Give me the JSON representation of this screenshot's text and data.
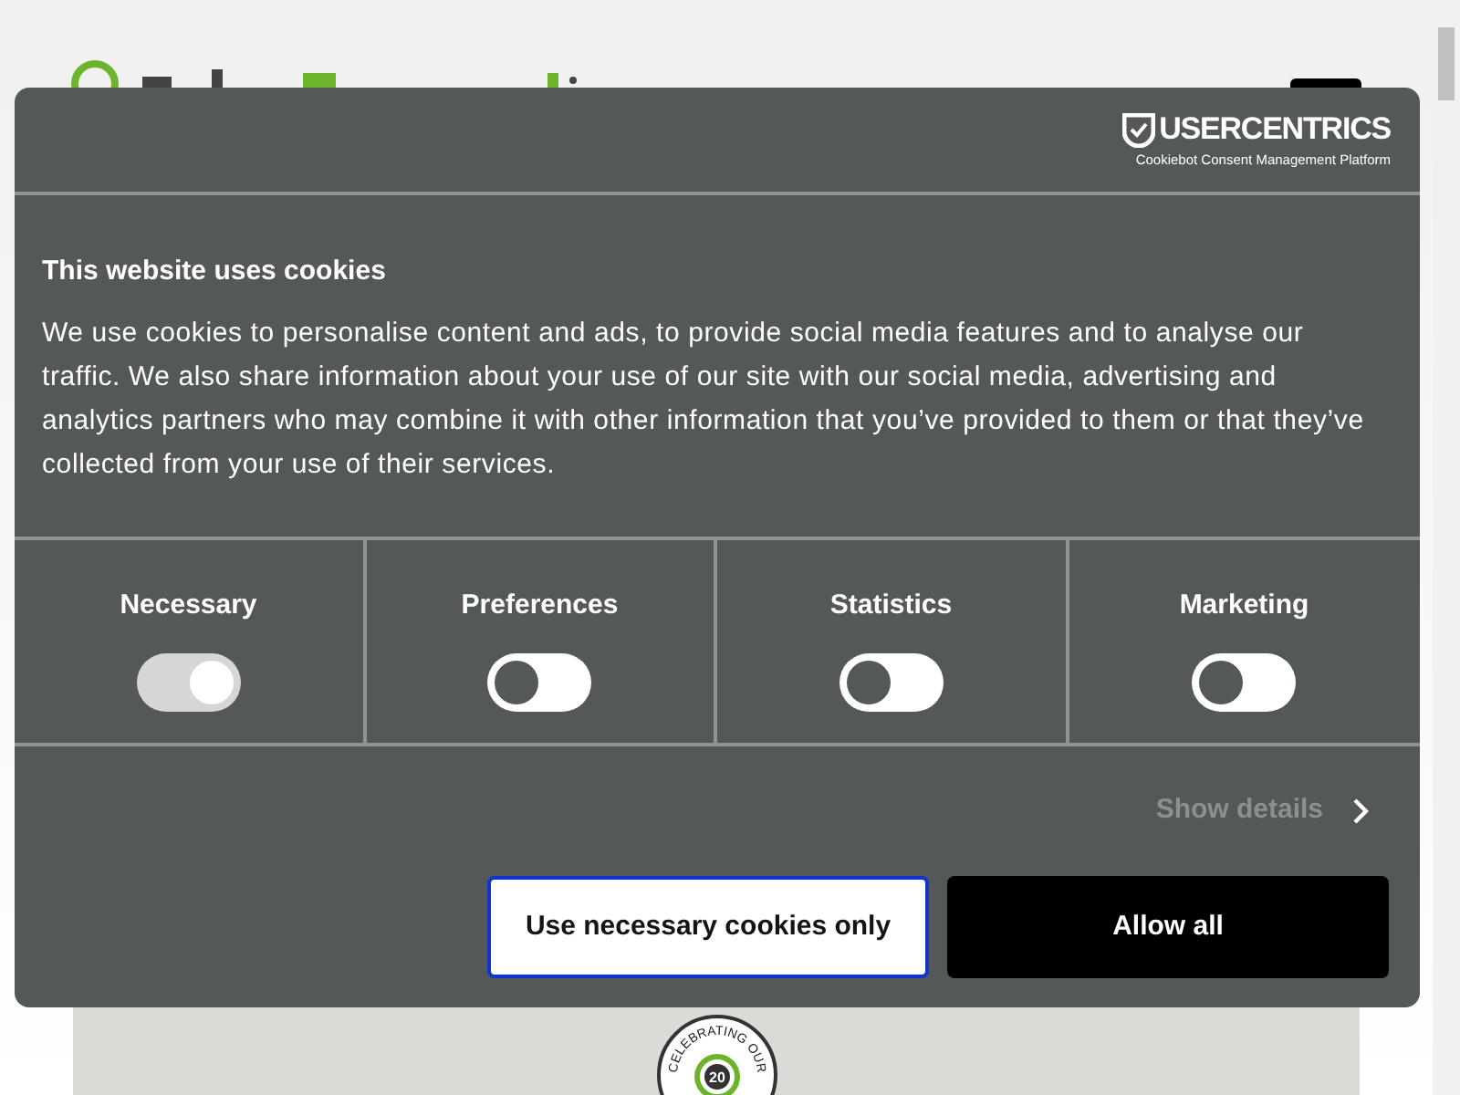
{
  "brand": {
    "name": "USERCENTRICS",
    "tagline": "Cookiebot Consent Management Platform"
  },
  "title": "This website uses cookies",
  "body": "We use cookies to personalise content and ads, to provide social media features and to analyse our traffic. We also share information about your use of our site with our social media, advertising and analytics partners who may combine it with other information that you’ve provided to them or that they’ve collected from your use of their services.",
  "categories": [
    {
      "label": "Necessary",
      "checked": true,
      "disabled": true
    },
    {
      "label": "Preferences",
      "checked": false,
      "disabled": false
    },
    {
      "label": "Statistics",
      "checked": false,
      "disabled": false
    },
    {
      "label": "Marketing",
      "checked": false,
      "disabled": false
    }
  ],
  "details_link": "Show details",
  "buttons": [
    {
      "label": "Use necessary cookies only",
      "kind": "outline"
    },
    {
      "label": "Allow all",
      "kind": "primary"
    }
  ],
  "badge": {
    "arc_text": "CELEBRATING OUR",
    "number": "20"
  }
}
